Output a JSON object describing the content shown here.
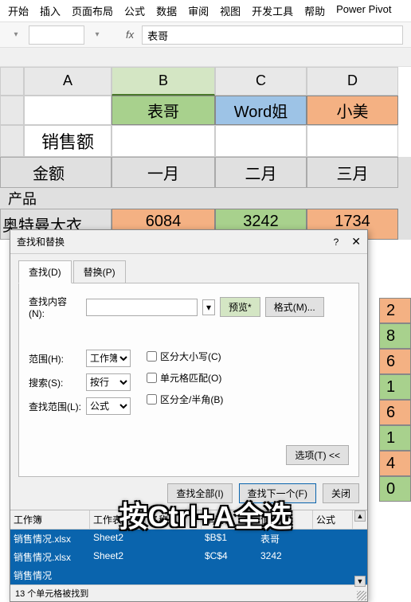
{
  "ribbon": [
    "开始",
    "插入",
    "页面布局",
    "公式",
    "数据",
    "审阅",
    "视图",
    "开发工具",
    "帮助",
    "Power Pivot"
  ],
  "formula_bar": {
    "fx": "fx",
    "value": "表哥"
  },
  "columns": [
    "A",
    "B",
    "C",
    "D"
  ],
  "headers": {
    "b": "表哥",
    "c": "Word姐",
    "d": "小美"
  },
  "labels": {
    "sales": "销售额",
    "amount": "金额",
    "product": "产品"
  },
  "months": [
    "一月",
    "二月",
    "三月"
  ],
  "rows": [
    {
      "name": "奥特曼大衣",
      "vals": [
        "6084",
        "3242",
        "1734"
      ]
    }
  ],
  "side_vals": [
    "2",
    "8",
    "6",
    "1",
    "6",
    "1",
    "4",
    "0"
  ],
  "dialog": {
    "title": "查找和替换",
    "help": "?",
    "tabs": {
      "find": "查找(D)",
      "replace": "替换(P)"
    },
    "find_label": "查找内容(N):",
    "find_value": "",
    "preview": "预览*",
    "format": "格式(M)...",
    "scope_label": "范围(H):",
    "scope_value": "工作簿",
    "search_label": "搜索(S):",
    "search_value": "按行",
    "lookin_label": "查找范围(L):",
    "lookin_value": "公式",
    "match_case": "区分大小写(C)",
    "match_cell": "单元格匹配(O)",
    "match_width": "区分全/半角(B)",
    "options": "选项(T) <<",
    "find_all": "查找全部(I)",
    "find_next": "查找下一个(F)",
    "close": "关闭",
    "cols": {
      "workbook": "工作簿",
      "sheet": "工作表",
      "name": "名称",
      "cell": "单元格",
      "value": "值",
      "formula": "公式"
    },
    "results": [
      {
        "wb": "销售情况.xlsx",
        "sh": "Sheet2",
        "nm": "",
        "cl": "$B$1",
        "vl": "表哥",
        "fm": ""
      },
      {
        "wb": "销售情况.xlsx",
        "sh": "Sheet2",
        "nm": "",
        "cl": "$C$4",
        "vl": "3242",
        "fm": ""
      },
      {
        "wb": "销售情况",
        "sh": "",
        "nm": "",
        "cl": "",
        "vl": "",
        "fm": ""
      }
    ],
    "status": "13 个单元格被找到"
  },
  "overlay": "按Ctrl+A全选"
}
